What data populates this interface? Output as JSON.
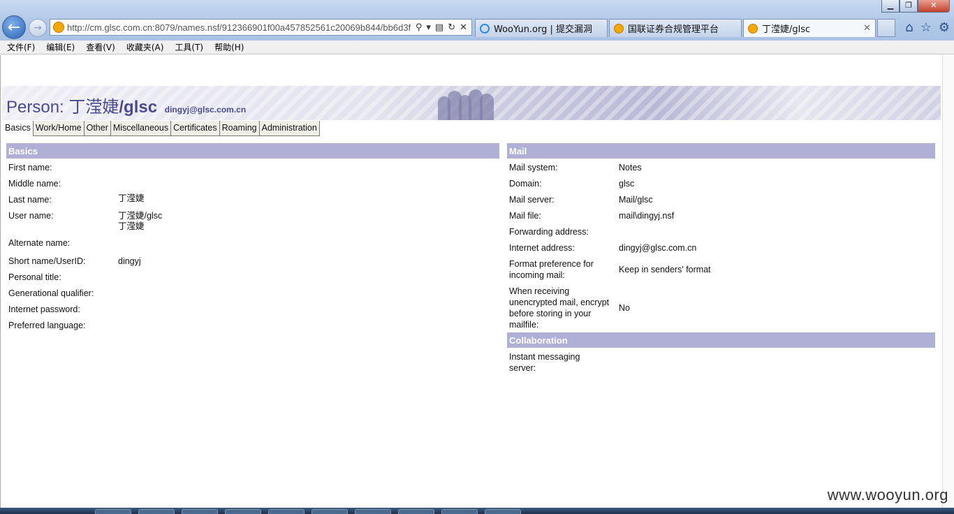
{
  "browser": {
    "url": "http://cm.glsc.com.cn:8079/names.nsf/912366901f00a457852561c20069b844/bb6d3f",
    "tabs": [
      {
        "label": "WooYun.org | 提交漏洞",
        "icon": "ie-icon",
        "active": false
      },
      {
        "label": "国联证券合规管理平台",
        "icon": "notes-icon",
        "active": false
      },
      {
        "label": "丁滢婕/glsc",
        "icon": "notes-icon",
        "active": true
      }
    ],
    "tab_close": "✕",
    "menu": [
      "文件(F)",
      "编辑(E)",
      "查看(V)",
      "收藏夹(A)",
      "工具(T)",
      "帮助(H)"
    ]
  },
  "header": {
    "prefix": "Person: ",
    "name_cn": "丁滢婕",
    "name_org": "/glsc",
    "email": "dingyj@glsc.com.cn"
  },
  "doc_tabs": [
    "Basics",
    "Work/Home",
    "Other",
    "Miscellaneous",
    "Certificates",
    "Roaming",
    "Administration"
  ],
  "basics": {
    "title": "Basics",
    "fields": [
      {
        "label": "First name:",
        "value": ""
      },
      {
        "label": "Middle name:",
        "value": ""
      },
      {
        "label": "Last name:",
        "value": "丁滢婕"
      },
      {
        "label": "User name:",
        "value": "丁滢婕/glsc",
        "value2": "丁滢婕"
      },
      {
        "label": "Alternate name:",
        "value": ""
      },
      {
        "label": "Short name/UserID:",
        "value": "dingyj"
      },
      {
        "label": "Personal title:",
        "value": ""
      },
      {
        "label": "Generational qualifier:",
        "value": ""
      },
      {
        "label": "Internet password:",
        "value": ""
      },
      {
        "label": "Preferred language:",
        "value": ""
      }
    ]
  },
  "mail": {
    "title": "Mail",
    "fields": [
      {
        "label": "Mail system:",
        "value": "Notes"
      },
      {
        "label": "Domain:",
        "value": "glsc"
      },
      {
        "label": "Mail server:",
        "value": "Mail/glsc"
      },
      {
        "label": "Mail file:",
        "value": "mail\\dingyj.nsf"
      },
      {
        "label": "Forwarding address:",
        "value": ""
      },
      {
        "label": "Internet address:",
        "value": "dingyj@glsc.com.cn"
      },
      {
        "label": "Format preference for incoming mail:",
        "value": "Keep in senders' format"
      },
      {
        "label": "When receiving unencrypted mail, encrypt before storing in your mailfile:",
        "value": "No"
      }
    ]
  },
  "collaboration": {
    "title": "Collaboration",
    "fields": [
      {
        "label": "Instant messaging server:",
        "value": ""
      }
    ]
  },
  "watermark": "www.wooyun.org",
  "colors": {
    "section_header": "#b0b0d6",
    "title_text": "#4a4a8e"
  }
}
